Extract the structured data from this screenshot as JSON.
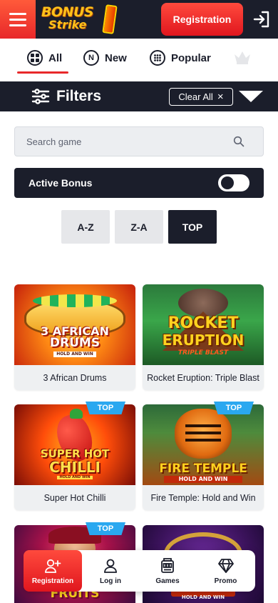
{
  "header": {
    "logo_line1": "BONUS",
    "logo_line2": "Strike",
    "registration_label": "Registration"
  },
  "tabs": [
    {
      "label": "All",
      "icon": "grid-icon",
      "active": true
    },
    {
      "label": "New",
      "icon": "n-circle-icon",
      "active": false
    },
    {
      "label": "Popular",
      "icon": "dice-icon",
      "active": false
    }
  ],
  "tab_new_icon_letter": "N",
  "filters": {
    "title": "Filters",
    "clear_label": "Clear All",
    "clear_icon": "×"
  },
  "search": {
    "placeholder": "Search game",
    "value": ""
  },
  "active_bonus": {
    "label": "Active Bonus",
    "enabled": false
  },
  "sort": [
    "A-Z",
    "Z-A",
    "TOP"
  ],
  "sort_selected": "TOP",
  "games": [
    {
      "name": "3 African Drums",
      "title_line1": "3 AFRICAN",
      "title_line2": "DRUMS",
      "subtitle": "HOLD AND WIN",
      "badge": ""
    },
    {
      "name": "Rocket Eruption: Triple Blast",
      "title_line1": "ROCKET",
      "title_line2": "ERUPTION",
      "subtitle": "TRIPLE BLAST",
      "badge": ""
    },
    {
      "name": "Super Hot Chilli",
      "title_line1": "SUPER HOT",
      "title_line2": "CHILLI",
      "subtitle": "HOLD AND WIN",
      "badge": "TOP"
    },
    {
      "name": "Fire Temple: Hold and Win",
      "title_line1": "FIRE TEMPLE",
      "title_line2": "",
      "subtitle": "HOLD AND WIN",
      "badge": "TOP"
    },
    {
      "name": "",
      "title_line1": "FRUITS",
      "title_line2": "",
      "subtitle": "",
      "badge": "TOP"
    },
    {
      "name": "",
      "title_line1": "",
      "title_line2": "",
      "subtitle": "HOLD AND WIN",
      "badge": ""
    }
  ],
  "bottom_nav": [
    {
      "label": "Registration",
      "icon": "add-user-icon",
      "active": true
    },
    {
      "label": "Log in",
      "icon": "user-icon",
      "active": false
    },
    {
      "label": "Games",
      "icon": "slot-machine-icon",
      "active": false
    },
    {
      "label": "Promo",
      "icon": "diamond-icon",
      "active": false
    }
  ],
  "colors": {
    "dark": "#1b1e2b",
    "accent": "#e8282a",
    "badge": "#2aa8f0"
  }
}
